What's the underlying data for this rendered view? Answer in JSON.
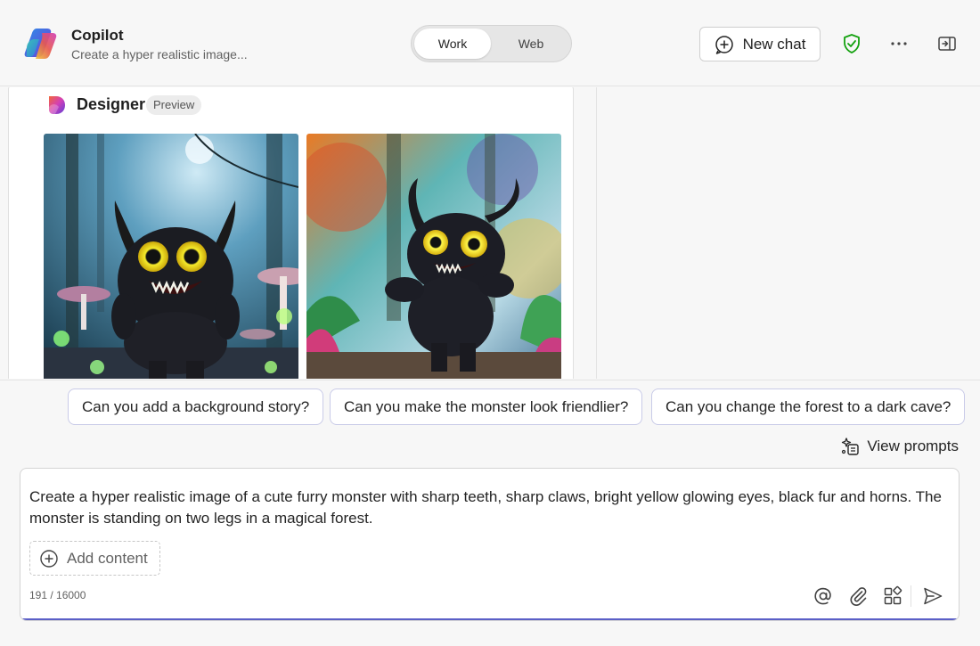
{
  "header": {
    "app_title": "Copilot",
    "subtitle": "Create a hyper realistic image...",
    "toggle": {
      "work_label": "Work",
      "web_label": "Web",
      "selected": "Work"
    },
    "new_chat_label": "New chat",
    "icons": [
      "copilot-logo",
      "new-chat-icon",
      "shield-check-icon",
      "more-icon",
      "open-panel-icon"
    ],
    "colors": {
      "shield": "#13a10e"
    }
  },
  "designer": {
    "label": "Designer",
    "badge": "Preview",
    "images": [
      {
        "icon": "monster-image-1"
      },
      {
        "icon": "monster-image-2"
      }
    ]
  },
  "suggestions": [
    "Can you add a background story?",
    "Can you make the monster look friendlier?",
    "Can you change the forest to a dark cave?"
  ],
  "view_prompts_label": "View prompts",
  "composer": {
    "prompt": "Create a hyper realistic image of a cute furry monster with sharp teeth, sharp claws, bright yellow glowing eyes, black fur and horns. The monster is standing on two legs in a magical forest.",
    "add_content_label": "Add content",
    "char_count": "191 / 16000",
    "icons": [
      "mention-icon",
      "attach-icon",
      "apps-icon",
      "send-icon"
    ],
    "accent": "#5b5fc7"
  }
}
